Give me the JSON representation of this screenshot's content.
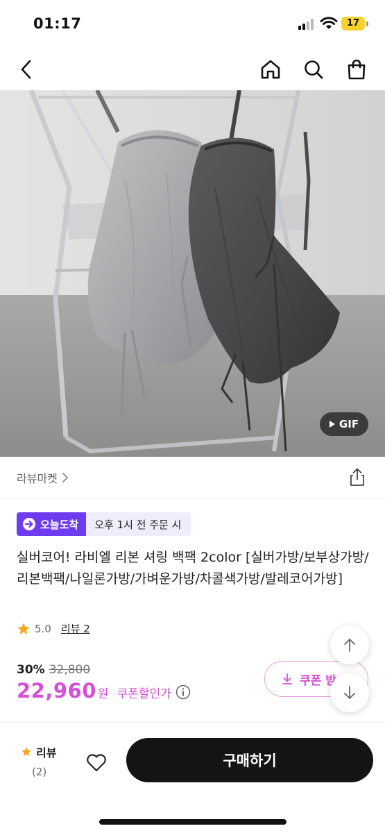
{
  "status_bar": {
    "time": "01:17",
    "battery": "17"
  },
  "hero": {
    "badge_label": "GIF"
  },
  "shop": {
    "name": "라뷰마켓"
  },
  "delivery": {
    "badge": "오늘도착",
    "note": "오후 1시 전 주문 시"
  },
  "product": {
    "title": "실버코어! 라비엘 리본 셔링 백팩 2color [실버가방/보부상가방/리본백팩/나일론가방/가벼운가방/차콜색가방/발레코어가방]",
    "rating": "5.0",
    "review_link": "리뷰 2",
    "discount": "30%",
    "original_price": "32,800",
    "price": "22,960",
    "currency": "원",
    "coupon_price_label": "쿠폰할인가",
    "coupon_button": "쿠폰 받"
  },
  "bottom_bar": {
    "review_label": "리뷰",
    "review_count": "(2)",
    "buy_label": "구매하기"
  },
  "colors": {
    "accent_pink": "#d64fd6",
    "delivery_purple": "#6d3cf0",
    "buy_black": "#141414",
    "star": "#f5a623"
  }
}
